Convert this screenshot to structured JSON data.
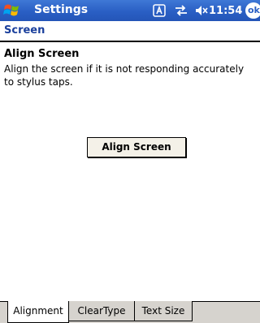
{
  "titlebar": {
    "title": "Settings",
    "time": "11:54",
    "ok_label": "ok",
    "status_icons": [
      "input-mode-icon",
      "connectivity-icon",
      "volume-icon"
    ]
  },
  "page": {
    "title": "Screen"
  },
  "align": {
    "heading": "Align Screen",
    "description": "Align the screen if it is not responding accurately to stylus taps.",
    "button_label": "Align Screen"
  },
  "tabs": [
    {
      "label": "Alignment",
      "active": true
    },
    {
      "label": "ClearType",
      "active": false
    },
    {
      "label": "Text Size",
      "active": false
    }
  ],
  "colors": {
    "titlebar": "#2a5fc4",
    "page_title": "#1a3f9c",
    "tab_strip": "#d6d3ce"
  }
}
